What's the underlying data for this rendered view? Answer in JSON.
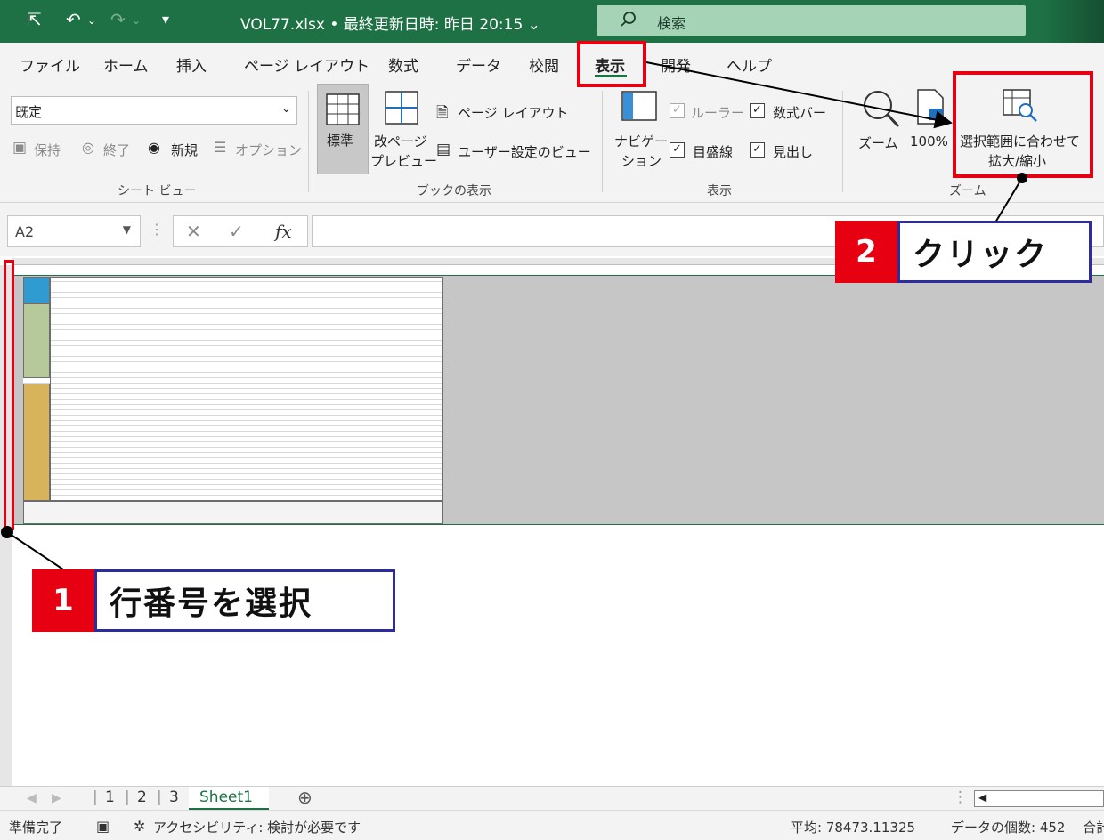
{
  "titlebar": {
    "title": "VOL77.xlsx • 最終更新日時: 昨日 20:15 ⌄",
    "search_placeholder": "検索"
  },
  "tabs": [
    "ファイル",
    "ホーム",
    "挿入",
    "ページ レイアウト",
    "数式",
    "データ",
    "校閲",
    "表示",
    "開発",
    "ヘルプ"
  ],
  "active_tab": "表示",
  "ribbon": {
    "sheet_view": {
      "select_value": "既定",
      "keep": "保持",
      "exit": "終了",
      "new": "新規",
      "options": "オプション",
      "label": "シート ビュー"
    },
    "workbook_views": {
      "normal": "標準",
      "page_break_1": "改ページ",
      "page_break_2": "プレビュー",
      "page_layout": "ページ レイアウト",
      "custom_views": "ユーザー設定のビュー",
      "label": "ブックの表示"
    },
    "show": {
      "navigation_1": "ナビゲー",
      "navigation_2": "ション",
      "ruler": "ルーラー",
      "formula_bar": "数式バー",
      "gridlines": "目盛線",
      "headings": "見出し",
      "label": "表示"
    },
    "zoom": {
      "zoom": "ズーム",
      "zoom_100": "100%",
      "zoom_selection_1": "選択範囲に合わせて",
      "zoom_selection_2": "拡大/縮小",
      "label": "ズーム"
    }
  },
  "formula_bar": {
    "name_box": "A2",
    "fx": "fx"
  },
  "sheets": {
    "items": [
      "1",
      "2",
      "3",
      "Sheet1"
    ],
    "active": "Sheet1"
  },
  "status": {
    "ready": "準備完了",
    "accessibility": "アクセシビリティ: 検討が必要です",
    "average": "平均: 78473.11325",
    "count": "データの個数: 452",
    "sum_cut": "合計"
  },
  "annotations": {
    "step1_num": "1",
    "step1_text": "行番号を選択",
    "step2_num": "2",
    "step2_text": "クリック"
  },
  "colors": {
    "excel_green": "#1e7145",
    "highlight_red": "#e60012",
    "callout_border": "#2e2aa0"
  }
}
